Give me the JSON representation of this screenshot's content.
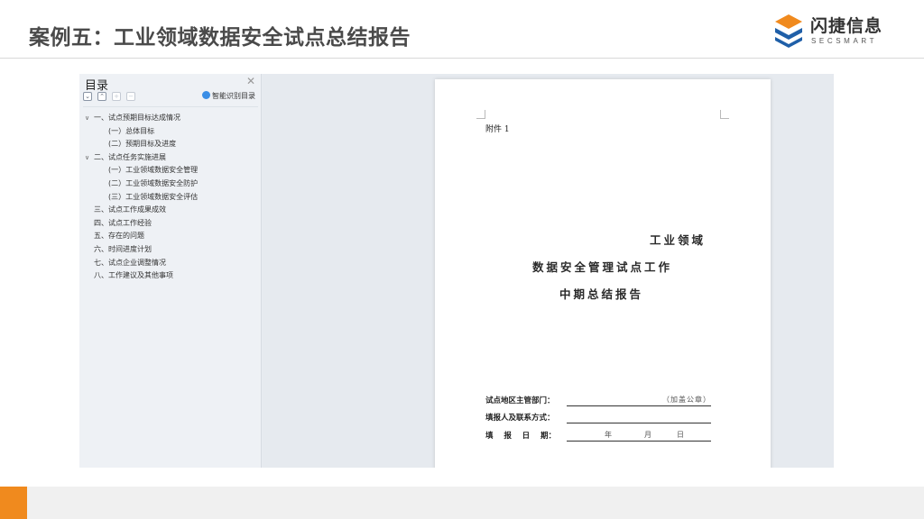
{
  "slide": {
    "title": "案例五：工业领域数据安全试点总结报告"
  },
  "logo": {
    "cn": "闪捷信息",
    "en": "SECSMART",
    "icon": "secsmart-logo-icon"
  },
  "toc": {
    "title": "目录",
    "close_icon": "close-icon",
    "smart_label": "智能识别目录",
    "items": [
      {
        "label": "一、试点预期目标达成情况"
      },
      {
        "label": "(一）总体目标"
      },
      {
        "label": "(二）预期目标及进度"
      },
      {
        "label": "二、试点任务实施进展"
      },
      {
        "label": "(一）工业领域数据安全管理"
      },
      {
        "label": "(二）工业领域数据安全防护"
      },
      {
        "label": "(三）工业领域数据安全评估"
      },
      {
        "label": "三、试点工作成果成效"
      },
      {
        "label": "四、试点工作经验"
      },
      {
        "label": "五、存在的问题"
      },
      {
        "label": "六、时间进度计划"
      },
      {
        "label": "七、试点企业调整情况"
      },
      {
        "label": "八、工作建议及其他事项"
      }
    ]
  },
  "document": {
    "attachment": "附件 1",
    "cover_line1": "工业领域",
    "cover_line2": "数据安全管理试点工作",
    "cover_line3": "中期总结报告",
    "field1_label": "试点地区主管部门：",
    "field1_value": "（加盖公章）",
    "field2_label": "填报人及联系方式：",
    "field3_label": "填    报    日    期：",
    "field3_year": "年",
    "field3_month": "月",
    "field3_day": "日"
  },
  "colors": {
    "accent": "#f08a1e",
    "logo_blue": "#1f5fa8"
  }
}
